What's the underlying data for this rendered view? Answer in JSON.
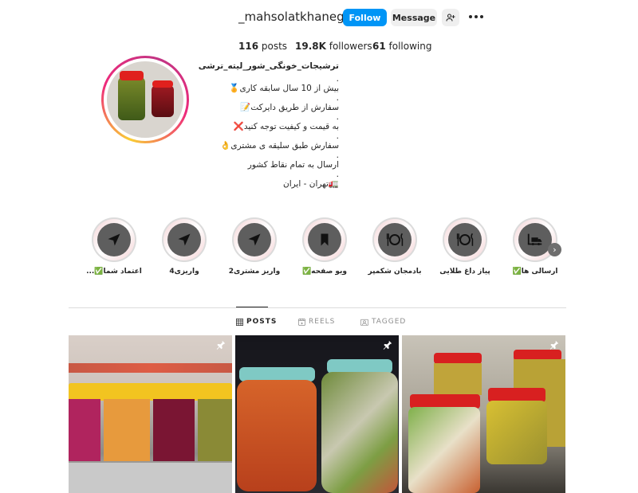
{
  "profile": {
    "username": "_mahsolatkhanegi_",
    "follow_label": "Follow",
    "message_label": "Message",
    "add_user_icon": "add-user-icon",
    "more_icon": "more-options-icon"
  },
  "stats": {
    "posts_count": "116",
    "posts_label": " posts",
    "followers_count": "19.8K",
    "followers_label": " followers",
    "following_count": "61",
    "following_label": " following"
  },
  "bio": {
    "name": "ترشیجات_خونگی_شور_لیته_ترشی",
    "lines": [
      "بیش از 10 سال سابقه کاری🏅",
      "سفارش از طریق دایرکت📝",
      "به قیمت و کیفیت توجه کنید❌",
      "سفارش طبق سلیقه ی مشتری👌",
      "ارسال به تمام نقاط کشور",
      "🚛تهران - ایران"
    ],
    "dot": "."
  },
  "highlights": [
    {
      "label": "اعتماد شما✅...",
      "icon": "navigation-arrow-icon"
    },
    {
      "label": "واریزی4",
      "icon": "navigation-arrow-icon"
    },
    {
      "label": "واریز مشتری2",
      "icon": "navigation-arrow-icon"
    },
    {
      "label": "ویو صفحه✅",
      "icon": "bookmark-icon"
    },
    {
      "label": "بادمجان شکمپر",
      "icon": "restaurant-icon"
    },
    {
      "label": "پیاز داغ طلایی",
      "icon": "restaurant-icon"
    },
    {
      "label": "ارسالی ها✅",
      "icon": "delivery-truck-icon"
    }
  ],
  "tabs": [
    {
      "label": "POSTS",
      "icon": "grid-icon",
      "active": true
    },
    {
      "label": "REELS",
      "icon": "reels-icon",
      "active": false
    },
    {
      "label": "TAGGED",
      "icon": "tagged-icon",
      "active": false
    }
  ],
  "posts": [
    {
      "icon": "pin-icon"
    },
    {
      "icon": "pin-icon"
    },
    {
      "icon": "pin-icon"
    }
  ],
  "colors": {
    "follow_button": "#0095f6",
    "secondary_button": "#efefef",
    "text": "#262626",
    "muted": "#8e8e8e",
    "divider": "#dbdbdb"
  }
}
